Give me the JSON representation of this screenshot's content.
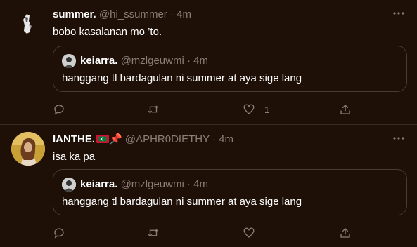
{
  "tweets": [
    {
      "display_name": "summer.",
      "handle": "@hi_ssummer",
      "time": "· 4m",
      "text": "bobo kasalanan mo ’to.",
      "quote": {
        "display_name": "keiarra.",
        "handle": "@mzlgeuwmi",
        "time": "· 4m",
        "text": "hanggang tl bardagulan ni summer at aya sige lang"
      },
      "actions": {
        "reply": "",
        "retweet": "",
        "like": "1",
        "share": ""
      }
    },
    {
      "display_name": "IANTHE.",
      "name_emoji": "📌",
      "handle": "@APHR0DIETHY",
      "time": "· 4m",
      "text": "isa ka pa",
      "quote": {
        "display_name": "keiarra.",
        "handle": "@mzlgeuwmi",
        "time": "· 4m",
        "text": "hanggang tl bardagulan ni summer at aya sige lang"
      },
      "actions": {
        "reply": "",
        "retweet": "",
        "like": "",
        "share": ""
      }
    }
  ],
  "colors": {
    "background": "#1e0f07",
    "secondary_text": "#8b7e77",
    "border": "#4a3a31"
  },
  "icons": [
    "more-icon",
    "reply-icon",
    "retweet-icon",
    "like-icon",
    "share-icon"
  ]
}
